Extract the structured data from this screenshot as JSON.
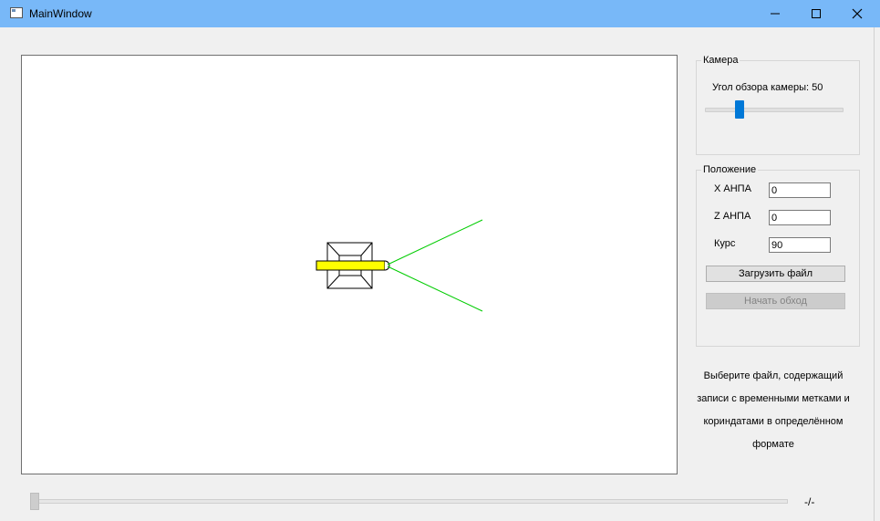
{
  "window": {
    "title": "MainWindow",
    "controls": [
      "minimize-icon",
      "maximize-icon",
      "close-icon"
    ]
  },
  "camera": {
    "group_title": "Камера",
    "fov_label": "Угол обзора камеры: 50",
    "fov_value": 50
  },
  "position": {
    "group_title": "Положение",
    "x_label": "X АНПА",
    "x_value": "0",
    "z_label": "Z АНПА",
    "z_value": "0",
    "course_label": "Курс",
    "course_value": "90",
    "load_button": "Загрузить файл",
    "start_button": "Начать обход"
  },
  "hint": {
    "line1": "Выберите файл, содержащий",
    "line2": "записи с временными метками и",
    "line3": "кориндатами в определённом",
    "line4": "формате"
  },
  "timeline": {
    "label": "-/-"
  },
  "colors": {
    "titlebar": "#78b8f8",
    "vehicle_body": "#ffff00",
    "view_rays": "#00cc00",
    "slider_accent": "#0078d7"
  }
}
